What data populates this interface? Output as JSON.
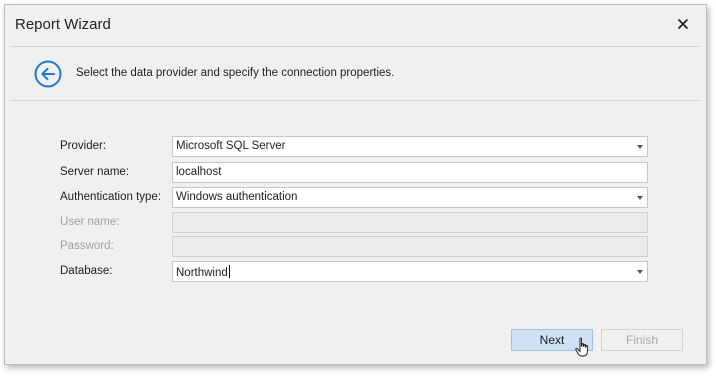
{
  "window": {
    "title": "Report Wizard"
  },
  "header": {
    "instruction": "Select the data provider and specify the connection properties."
  },
  "form": {
    "provider": {
      "label": "Provider:",
      "value": "Microsoft SQL Server"
    },
    "server_name": {
      "label": "Server name:",
      "value": "localhost"
    },
    "authentication_type": {
      "label": "Authentication type:",
      "value": "Windows authentication"
    },
    "user_name": {
      "label": "User name:",
      "value": ""
    },
    "password": {
      "label": "Password:",
      "value": ""
    },
    "database": {
      "label": "Database:",
      "value": "Northwind"
    }
  },
  "buttons": {
    "next": "Next",
    "finish": "Finish"
  },
  "icons": {
    "close": "close-icon",
    "back": "back-arrow-icon",
    "dropdown": "chevron-down-icon",
    "pointer": "mouse-pointer-icon"
  },
  "colors": {
    "accent": "#1e78d2",
    "next_button_bg": "#cfe1f5",
    "window_bg": "#f0f0f0"
  }
}
